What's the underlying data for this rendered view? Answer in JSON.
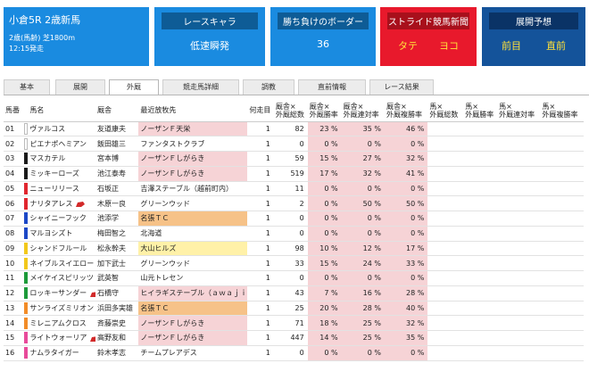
{
  "race": {
    "title": "小倉5R 2歳新馬",
    "line1": "2歳(馬齢) 芝1800m",
    "line2": "12:15発走"
  },
  "race_chara": {
    "label": "レースキャラ",
    "value": "低速瞬発"
  },
  "border": {
    "label": "勝ち負けのボーダー",
    "value": "36"
  },
  "stride": {
    "label": "ストライド競馬新聞",
    "tate": "タテ",
    "yoko": "ヨコ"
  },
  "tenkai": {
    "label": "展開予想",
    "a": "前目",
    "b": "直前"
  },
  "tabs": [
    "基本",
    "展開",
    "外厩",
    "競走馬詳細",
    "調教",
    "直前情報",
    "レース結果"
  ],
  "columns": [
    "馬番",
    "馬名",
    "厩舎",
    "最近放牧先",
    "何走目",
    "厩舎×\n外厩総数",
    "厩舎×\n外厩勝率",
    "厩舎×\n外厩連対率",
    "厩舎×\n外厩複勝率",
    "馬×\n外厩総数",
    "馬×\n外厩勝率",
    "馬×\n外厩連対率",
    "馬×\n外厩複勝率"
  ],
  "rows": [
    {
      "no": "01",
      "color": "#ffffff",
      "name": "ヴァルコス",
      "trainer": "友道康夫",
      "farm": "ノーザンＦ天栄",
      "farm_bg": "pk",
      "run": "1",
      "total": "82",
      "win": "23 %",
      "ren": "35 %",
      "fuku": "46 %",
      "cap": ""
    },
    {
      "no": "02",
      "color": "#ffffff",
      "name": "ピエナポヘミアン",
      "trainer": "飯田雄三",
      "farm": "ファンタストクラブ",
      "farm_bg": "",
      "run": "1",
      "total": "0",
      "win": "0 %",
      "ren": "0 %",
      "fuku": "0 %",
      "cap": ""
    },
    {
      "no": "03",
      "color": "#1a1a1a",
      "name": "マスカテル",
      "trainer": "宮本博",
      "farm": "ノーザンＦしがらき",
      "farm_bg": "pk",
      "run": "1",
      "total": "59",
      "win": "15 %",
      "ren": "27 %",
      "fuku": "32 %",
      "cap": ""
    },
    {
      "no": "04",
      "color": "#1a1a1a",
      "name": "ミッキーローズ",
      "trainer": "池江泰寿",
      "farm": "ノーザンＦしがらき",
      "farm_bg": "pk",
      "run": "1",
      "total": "519",
      "win": "17 %",
      "ren": "32 %",
      "fuku": "41 %",
      "cap": ""
    },
    {
      "no": "05",
      "color": "#e0262e",
      "name": "ニューリリース",
      "trainer": "石坂正",
      "farm": "吉澤ステーブル（越前町内）",
      "farm_bg": "",
      "run": "1",
      "total": "11",
      "win": "0 %",
      "ren": "0 %",
      "fuku": "0 %",
      "cap": ""
    },
    {
      "no": "06",
      "color": "#e0262e",
      "name": "ナリタアレス",
      "trainer": "木原一良",
      "farm": "グリーンウッド",
      "farm_bg": "",
      "run": "1",
      "total": "2",
      "win": "0 %",
      "ren": "50 %",
      "fuku": "50 %",
      "cap": "#d22a2a"
    },
    {
      "no": "07",
      "color": "#1c48c6",
      "name": "シャイニーフック",
      "trainer": "池添学",
      "farm": "名張ＴＣ",
      "farm_bg": "or",
      "run": "1",
      "total": "0",
      "win": "0 %",
      "ren": "0 %",
      "fuku": "0 %",
      "cap": ""
    },
    {
      "no": "08",
      "color": "#1c48c6",
      "name": "マルヨシズト",
      "trainer": "梅田智之",
      "farm": "北海道",
      "farm_bg": "",
      "run": "1",
      "total": "0",
      "win": "0 %",
      "ren": "0 %",
      "fuku": "0 %",
      "cap": ""
    },
    {
      "no": "09",
      "color": "#f2c81b",
      "name": "シャンドフルール",
      "trainer": "松永幹夫",
      "farm": "大山ヒルズ",
      "farm_bg": "ye",
      "run": "1",
      "total": "98",
      "win": "10 %",
      "ren": "12 %",
      "fuku": "17 %",
      "cap": ""
    },
    {
      "no": "10",
      "color": "#f2c81b",
      "name": "ネイブルスイエロー",
      "trainer": "加下武士",
      "farm": "グリーンウッド",
      "farm_bg": "",
      "run": "1",
      "total": "33",
      "win": "15 %",
      "ren": "24 %",
      "fuku": "33 %",
      "cap": ""
    },
    {
      "no": "11",
      "color": "#1d9a3a",
      "name": "メイケイスピリッツ",
      "trainer": "武英智",
      "farm": "山元トレセン",
      "farm_bg": "",
      "run": "1",
      "total": "0",
      "win": "0 %",
      "ren": "0 %",
      "fuku": "0 %",
      "cap": ""
    },
    {
      "no": "12",
      "color": "#1d9a3a",
      "name": "ロッキーサンダー",
      "trainer": "石橋守",
      "farm": "ヒイラギステーブル（ａｗａｊｉ）",
      "farm_bg": "pk",
      "run": "1",
      "total": "43",
      "win": "7 %",
      "ren": "16 %",
      "fuku": "28 %",
      "cap": "#d22a2a"
    },
    {
      "no": "13",
      "color": "#f28c28",
      "name": "サンライズミリオン",
      "trainer": "浜田多実雄",
      "farm": "名張ＴＣ",
      "farm_bg": "or",
      "run": "1",
      "total": "25",
      "win": "20 %",
      "ren": "28 %",
      "fuku": "40 %",
      "cap": ""
    },
    {
      "no": "14",
      "color": "#f28c28",
      "name": "ミレニアムクロス",
      "trainer": "斉藤崇史",
      "farm": "ノーザンＦしがらき",
      "farm_bg": "pk",
      "run": "1",
      "total": "71",
      "win": "18 %",
      "ren": "25 %",
      "fuku": "32 %",
      "cap": ""
    },
    {
      "no": "15",
      "color": "#e84a9a",
      "name": "ライトウォーリア",
      "trainer": "高野友和",
      "farm": "ノーザンＦしがらき",
      "farm_bg": "pk",
      "run": "1",
      "total": "447",
      "win": "14 %",
      "ren": "25 %",
      "fuku": "35 %",
      "cap": "#d22a2a"
    },
    {
      "no": "16",
      "color": "#e84a9a",
      "name": "ナムラタイガー",
      "trainer": "鈴木孝志",
      "farm": "チームプレアデス",
      "farm_bg": "",
      "run": "1",
      "total": "0",
      "win": "0 %",
      "ren": "0 %",
      "fuku": "0 %",
      "cap": ""
    }
  ]
}
